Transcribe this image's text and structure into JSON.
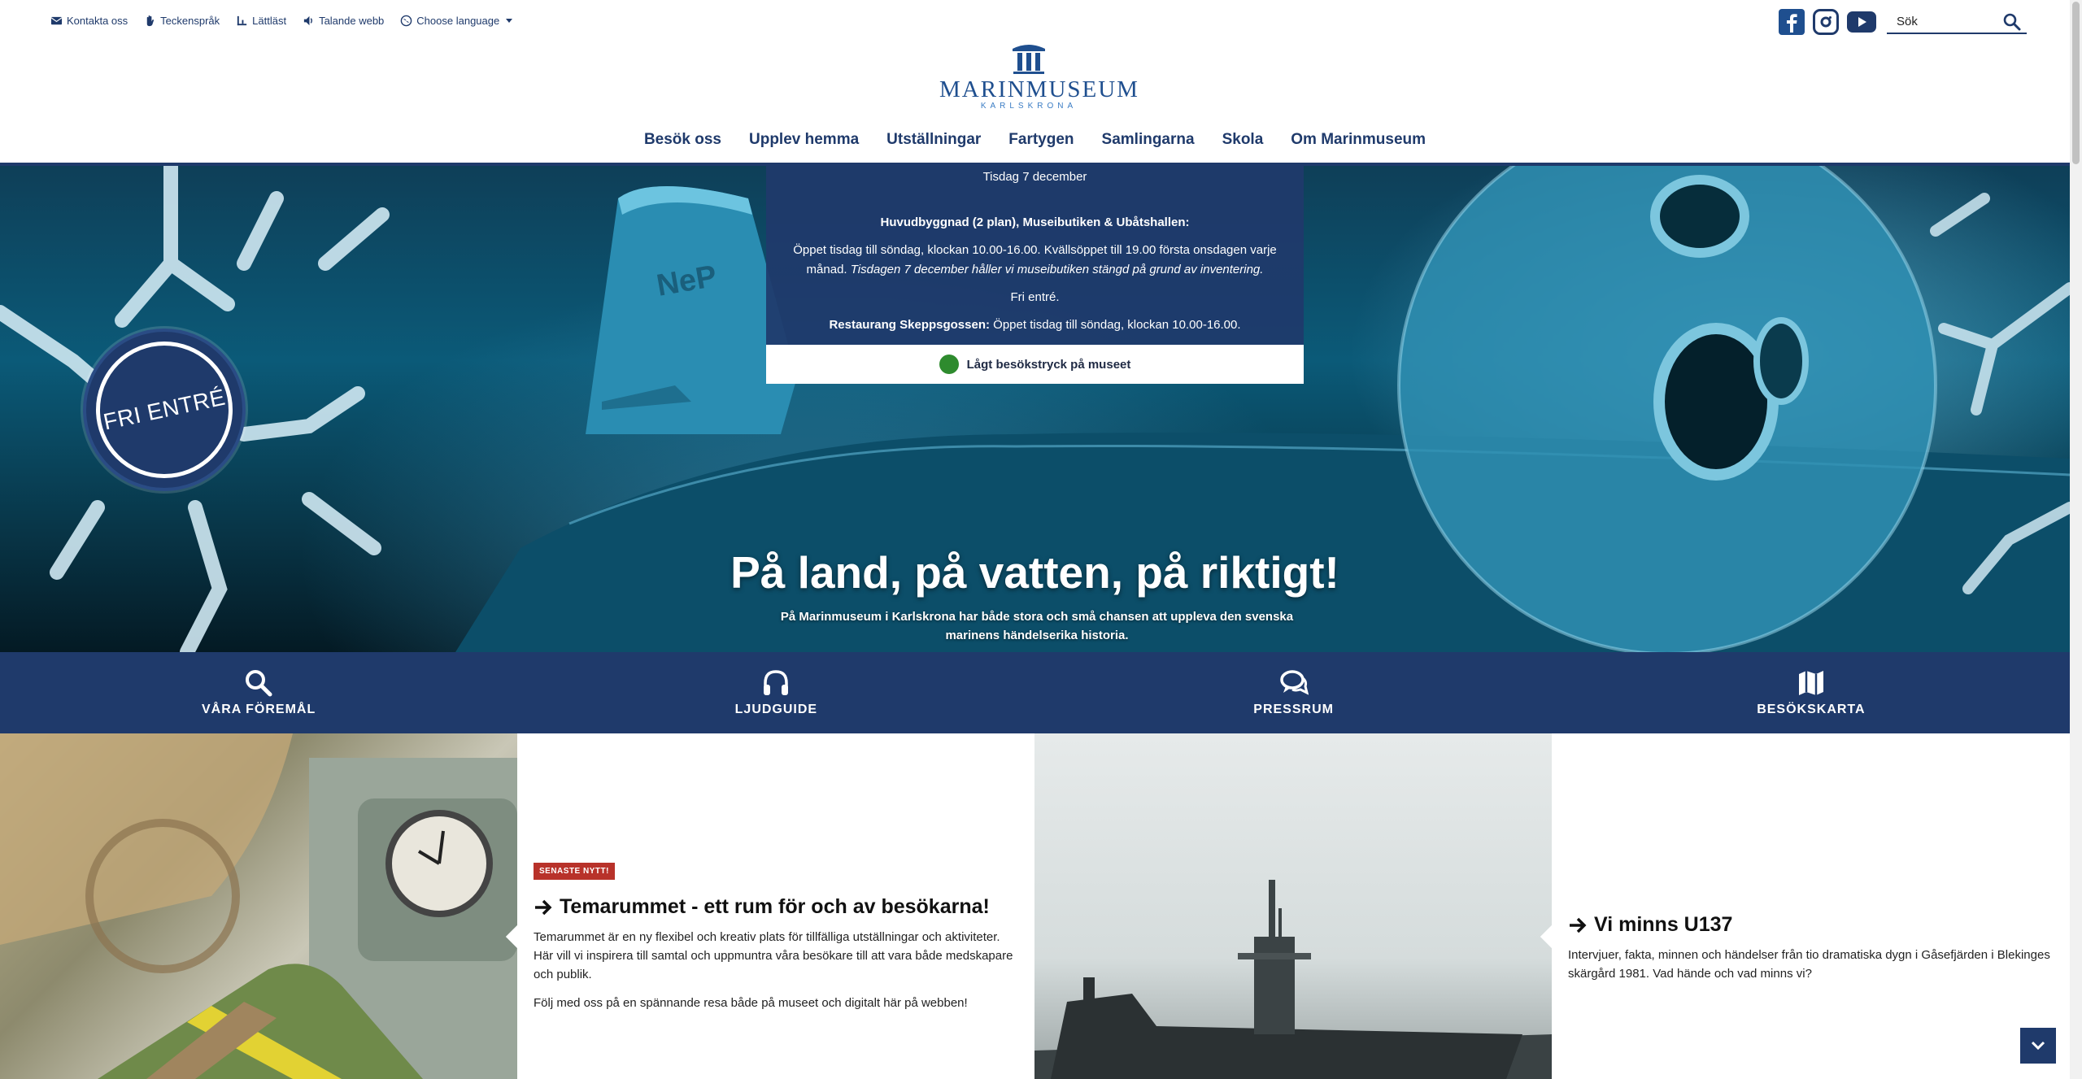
{
  "utility": {
    "contact": "Kontakta oss",
    "sign_language": "Teckenspråk",
    "easy_read": "Lättläst",
    "talking_web": "Talande webb",
    "language": "Choose language"
  },
  "search": {
    "placeholder": "Sök"
  },
  "logo": {
    "title": "MARINMUSEUM",
    "subtitle": "KARLSKRONA"
  },
  "nav": [
    "Besök oss",
    "Upplev hemma",
    "Utställningar",
    "Fartygen",
    "Samlingarna",
    "Skola",
    "Om Marinmuseum"
  ],
  "info": {
    "date": "Tisdag 7 december",
    "heading": "Huvudbyggnad (2 plan), Museibutiken & Ubåtshallen:",
    "hours": "Öppet tisdag till söndag, klockan 10.00-16.00. Kvällsöppet till 19.00 första onsdagen varje månad.",
    "notice": "Tisdagen 7 december håller vi museibutiken stängd på grund av inventering.",
    "free": "Fri entré.",
    "restaurant_label": "Restaurang Skeppsgossen:",
    "restaurant_hours": "Öppet tisdag till söndag, klockan 10.00-16.00.",
    "crowd_status": "Lågt besökstryck på museet",
    "crowd_color": "#2e8b2e"
  },
  "badge": {
    "text": "FRI ENTRÉ"
  },
  "hero": {
    "title": "På land, på vatten, på riktigt!",
    "subtitle": "På Marinmuseum i Karlskrona har både stora och små chansen att uppleva den svenska marinens händelserika historia."
  },
  "quick_links": [
    {
      "label": "VÅRA FÖREMÅL",
      "icon": "search-icon"
    },
    {
      "label": "LJUDGUIDE",
      "icon": "headphones-icon"
    },
    {
      "label": "PRESSRUM",
      "icon": "chat-icon"
    },
    {
      "label": "BESÖKSKARTA",
      "icon": "map-icon"
    }
  ],
  "cards": [
    {
      "tag": "SENASTE NYTT!",
      "title": "Temarummet - ett rum för och av besökarna!",
      "body": [
        "Temarummet är en ny flexibel och kreativ plats för tillfälliga utställningar och aktiviteter. Här vill vi inspirera till samtal och uppmuntra våra besökare till att vara både medskapare och publik.",
        "Följ med oss på en spännande resa både på museet och digitalt här på webben!"
      ]
    },
    {
      "title": "Vi minns U137",
      "body": [
        "Intervjuer, fakta, minnen och händelser från tio dramatiska dygn i Gåsefjärden i Blekinges skärgård 1981. Vad hände och vad minns vi?"
      ]
    }
  ],
  "colors": {
    "brand": "#1f3a6b",
    "tag": "#b8322a",
    "link": "#1f4f8f"
  }
}
